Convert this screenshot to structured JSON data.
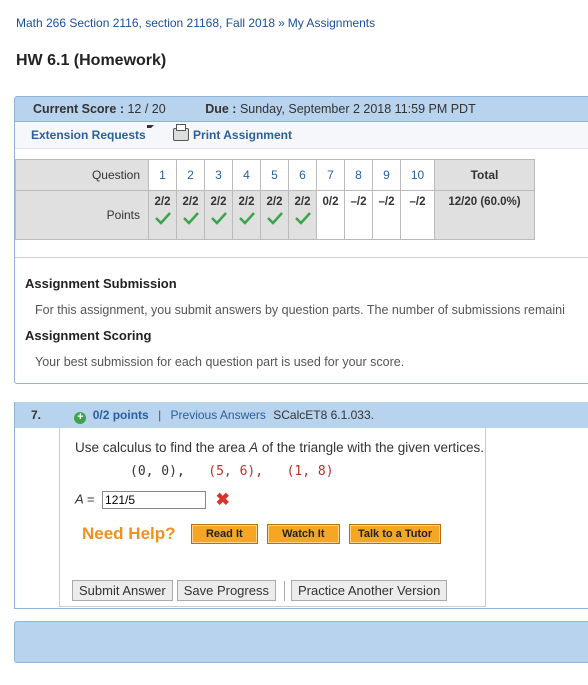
{
  "breadcrumb": {
    "course": "Math 266 Section 2116, section 21168, Fall 2018",
    "sep": "»",
    "page": "My Assignments"
  },
  "title": "HW 6.1 (Homework)",
  "score_bar": {
    "score_label": "Current Score :",
    "score_value": "12 / 20",
    "due_label": "Due :",
    "due_value": "Sunday, September 2 2018 11:59 PM PDT"
  },
  "links": {
    "extension": "Extension Requests",
    "print": "Print Assignment"
  },
  "grid": {
    "question_label": "Question",
    "points_label": "Points",
    "total_label": "Total",
    "total_value": "12/20 (60.0%)",
    "questions": [
      {
        "n": "1",
        "pts": "2/2",
        "correct": true
      },
      {
        "n": "2",
        "pts": "2/2",
        "correct": true
      },
      {
        "n": "3",
        "pts": "2/2",
        "correct": true
      },
      {
        "n": "4",
        "pts": "2/2",
        "correct": true
      },
      {
        "n": "5",
        "pts": "2/2",
        "correct": true
      },
      {
        "n": "6",
        "pts": "2/2",
        "correct": true
      },
      {
        "n": "7",
        "pts": "0/2",
        "correct": false
      },
      {
        "n": "8",
        "pts": "–/2",
        "correct": false
      },
      {
        "n": "9",
        "pts": "–/2",
        "correct": false
      },
      {
        "n": "10",
        "pts": "–/2",
        "correct": false
      }
    ]
  },
  "submission": {
    "heading": "Assignment Submission",
    "text": "For this assignment, you submit answers by question parts. The number of submissions remaini"
  },
  "scoring": {
    "heading": "Assignment Scoring",
    "text": "Your best submission for each question part is used for your score."
  },
  "question": {
    "number": "7.",
    "points": "0/2 points",
    "bar": "|",
    "previous": "Previous Answers",
    "source": "SCalcET8 6.1.033.",
    "prompt_pre": "Use calculus to find the area ",
    "prompt_var": "A",
    "prompt_post": " of the triangle with the given vertices.",
    "v1": "(0, 0),",
    "v2": "(5, 6),",
    "v3": "(1, 8)",
    "answer_label": "A =",
    "answer_value": "121/5",
    "need_help": "Need Help?",
    "read_it": "Read It",
    "watch_it": "Watch It",
    "tutor": "Talk to a Tutor",
    "submit": "Submit Answer",
    "save": "Save Progress",
    "practice": "Practice Another Version"
  },
  "colors": {
    "accent_bar": "#b8d3ee",
    "link": "#1a4f9c",
    "correct": "#3aa54a",
    "wrong": "#d9342b",
    "help": "#f5a623"
  }
}
